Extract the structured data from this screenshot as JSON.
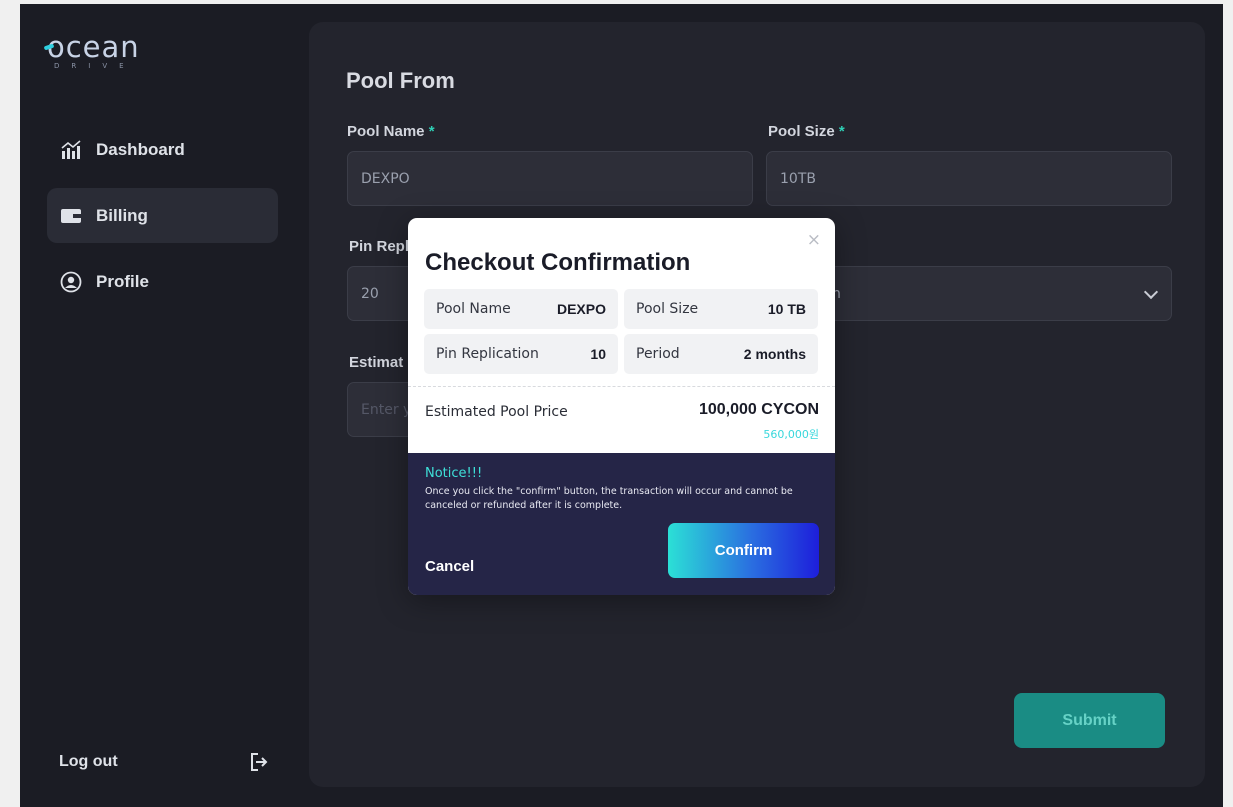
{
  "logo": {
    "word": "ocean",
    "sub": "DRIVE"
  },
  "sidebar": {
    "items": [
      {
        "label": "Dashboard",
        "icon": "dashboard-icon"
      },
      {
        "label": "Billing",
        "icon": "wallet-icon",
        "active": true
      },
      {
        "label": "Profile",
        "icon": "profile-icon"
      }
    ],
    "logout_label": "Log out"
  },
  "form": {
    "title": "Pool From",
    "pool_name_label": "Pool Name",
    "pool_name_value": "DEXPO",
    "pool_size_label": "Pool Size",
    "pool_size_value": "10TB",
    "pin_replication_label": "Pin Repl",
    "pin_replication_value": "20",
    "period_value_partial": "h",
    "estimate_label": "Estimat",
    "estimate_placeholder": "Enter y",
    "required_mark": "*",
    "submit_label": "Submit"
  },
  "modal": {
    "title": "Checkout Confirmation",
    "close_glyph": "×",
    "pool_name_label": "Pool Name",
    "pool_name_value": "DEXPO",
    "pool_size_label": "Pool Size",
    "pool_size_value": "10 TB",
    "pin_replication_label": "Pin Replication",
    "pin_replication_value": "10",
    "period_label": "Period",
    "period_value": "2 months",
    "estimated_label": "Estimated Pool Price",
    "estimated_value": "100,000 CYCON",
    "estimated_sub": "560,000원",
    "notice_title": "Notice!!!",
    "notice_text": "Once you click the \"confirm\" button, the transaction will occur and cannot be canceled or refunded after it is complete.",
    "cancel_label": "Cancel",
    "confirm_label": "Confirm"
  },
  "colors": {
    "app_bg": "#1b1c24",
    "panel_bg": "#23242d",
    "accent_teal": "#2fd0b6",
    "notice_bg": "#252547"
  }
}
